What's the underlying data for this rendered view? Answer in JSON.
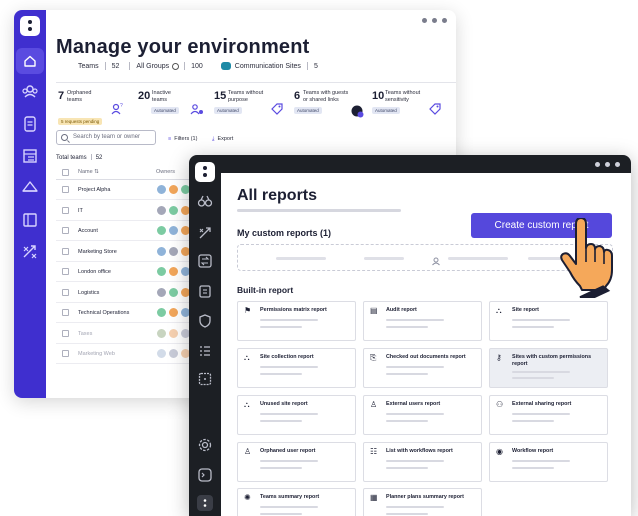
{
  "env_window": {
    "title": "Manage your environment",
    "stats": {
      "teams_label": "Teams",
      "teams_count": "52",
      "groups_label": "All Groups",
      "groups_count": "100",
      "sites_label": "Communication Sites",
      "sites_count": "5"
    },
    "metrics": [
      {
        "num": "7",
        "label": "Orphaned\nteams",
        "badge": "5 requests pending",
        "badge_kind": "warn",
        "icon": "user-question-icon"
      },
      {
        "num": "20",
        "label": "Inactive\nteams",
        "badge": "Automated",
        "badge_kind": "auto",
        "icon": "users-inactive-icon"
      },
      {
        "num": "15",
        "label": "Teams without\npurpose",
        "badge": "Automated",
        "badge_kind": "auto",
        "icon": "tag-icon"
      },
      {
        "num": "6",
        "label": "Teams with guests\nor shared links",
        "badge": "Automated",
        "badge_kind": "auto",
        "icon": "guest-link-icon"
      },
      {
        "num": "10",
        "label": "Teams without\nsensitivity",
        "badge": "Automated",
        "badge_kind": "auto",
        "icon": "label-icon"
      }
    ],
    "search_placeholder": "Search by team or owner",
    "filters_label": "Filters (1)",
    "export_label": "Export",
    "total_label": "Total teams",
    "total_count": "52",
    "col_name": "Name",
    "col_owners": "Owners",
    "rows": [
      {
        "name": "Project Alpha",
        "avatars": [
          "#8fb3d9",
          "#f2a65a",
          "#7ccba2",
          "#a4a7b8"
        ]
      },
      {
        "name": "IT",
        "avatars": [
          "#a4a7b8",
          "#7ccba2",
          "#f2a65a",
          "#8fb3d9"
        ]
      },
      {
        "name": "Account",
        "avatars": [
          "#7ccba2",
          "#8fb3d9",
          "#f2a65a",
          "#a4a7b8"
        ]
      },
      {
        "name": "Marketing Store",
        "avatars": [
          "#8fb3d9",
          "#a4a7b8",
          "#f2a65a",
          "#7ccba2"
        ]
      },
      {
        "name": "London office",
        "avatars": [
          "#7ccba2",
          "#f2a65a",
          "#8fb3d9",
          "#a4a7b8"
        ]
      },
      {
        "name": "Logistics",
        "avatars": [
          "#a4a7b8",
          "#7ccba2",
          "#f2a65a",
          "#8fb3d9"
        ]
      },
      {
        "name": "Technical Operations",
        "avatars": [
          "#7ccba2",
          "#f2a65a",
          "#8fb3d9",
          "#a4a7b8"
        ]
      },
      {
        "name": "Taxes",
        "avatars": [
          "#c8d4c0",
          "#f5d0b0",
          "#c8cbd8",
          "#d2dbe8"
        ]
      },
      {
        "name": "Marketing Web",
        "avatars": [
          "#d2dbe8",
          "#c8cbd8",
          "#f5d0b0",
          "#c8d4c0"
        ]
      }
    ],
    "rail_icons": [
      "home-icon",
      "teams-icon",
      "document-icon",
      "list-icon",
      "cloud-icon",
      "layout-icon",
      "compare-icon"
    ]
  },
  "reports_window": {
    "title": "All reports",
    "my_reports_label": "My custom reports (1)",
    "create_button": "Create custom report",
    "built_in_label": "Built-in report",
    "cards": [
      {
        "title": "Permissions matrix report",
        "icon": "flag-icon"
      },
      {
        "title": "Audit report",
        "icon": "audit-icon"
      },
      {
        "title": "Site report",
        "icon": "site-icon"
      },
      {
        "title": "Site collection report",
        "icon": "site-collection-icon"
      },
      {
        "title": "Checked out documents report",
        "icon": "documents-icon"
      },
      {
        "title": "Sites with custom permissions report",
        "icon": "key-icon"
      },
      {
        "title": "Unused site report",
        "icon": "unused-site-icon"
      },
      {
        "title": "External users report",
        "icon": "external-user-icon"
      },
      {
        "title": "External sharing report",
        "icon": "sharing-icon"
      },
      {
        "title": "Orphaned user report",
        "icon": "orphaned-user-icon"
      },
      {
        "title": "List with workflows report",
        "icon": "list-workflow-icon"
      },
      {
        "title": "Workflow report",
        "icon": "workflow-icon"
      },
      {
        "title": "Teams summary report",
        "icon": "teams-summary-icon"
      },
      {
        "title": "Planner plans summary report",
        "icon": "planner-icon"
      }
    ],
    "selected_card": "Sites with custom permissions report"
  },
  "colors": {
    "brand": "#3f2fcf",
    "button": "#5548dc",
    "dark_rail": "#1c1f24"
  }
}
